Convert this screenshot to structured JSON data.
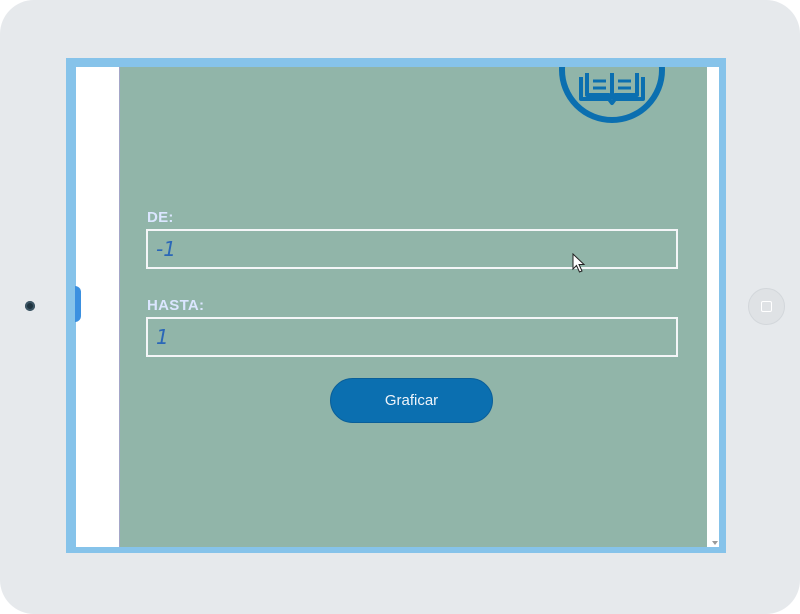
{
  "form": {
    "from_label": "DE:",
    "from_value": "-1",
    "to_label": "HASTA:",
    "to_value": "1"
  },
  "actions": {
    "plot_label": "Graficar"
  },
  "colors": {
    "device_frame": "#e6e9ec",
    "screen_border": "#86c3ea",
    "content_background": "#91b5a9",
    "field_border": "#f4f6f8",
    "value_text": "#2a67b8",
    "label_text": "#dbe6ff",
    "button_background": "#0b6fb0",
    "logo_ring": "#0b6fb0"
  },
  "icons": {
    "logo": "open-book-icon",
    "home": "home-button-icon",
    "camera": "front-camera-icon",
    "cursor": "mouse-pointer-icon"
  }
}
